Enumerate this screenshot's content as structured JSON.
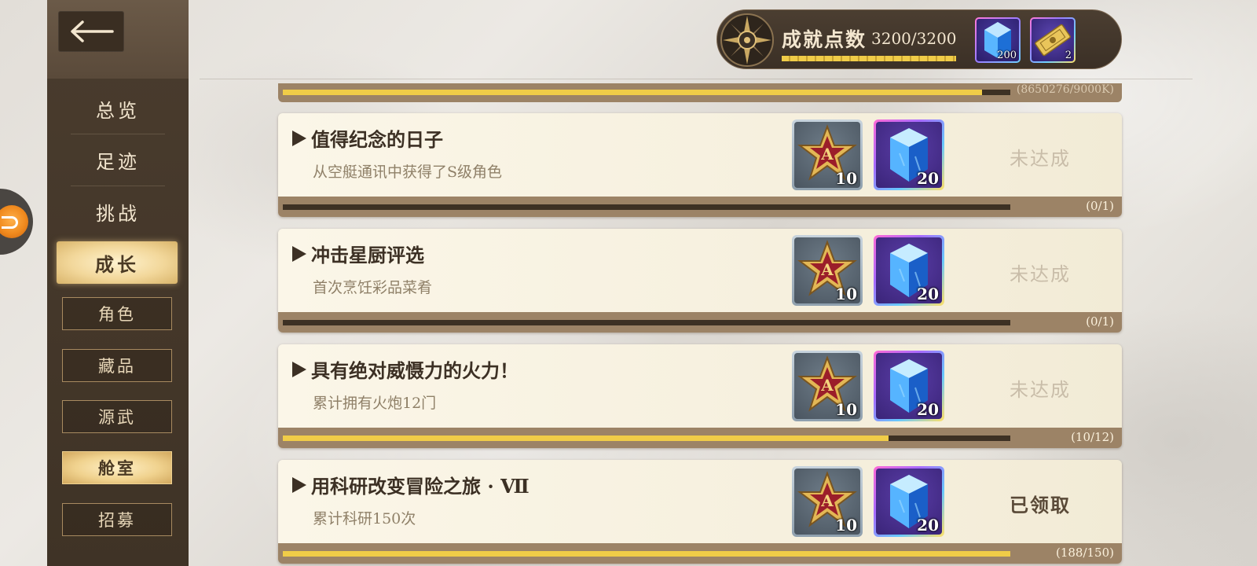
{
  "navigation": {
    "back_label": "",
    "main_items": [
      {
        "label": "总览",
        "active": false
      },
      {
        "label": "足迹",
        "active": false
      },
      {
        "label": "挑战",
        "active": false
      },
      {
        "label": "成长",
        "active": true
      }
    ],
    "sub_items": [
      {
        "label": "角色",
        "active": false
      },
      {
        "label": "藏品",
        "active": false
      },
      {
        "label": "源武",
        "active": false
      },
      {
        "label": "舱室",
        "active": true
      },
      {
        "label": "招募",
        "active": false
      }
    ]
  },
  "header": {
    "points_label": "成就点数",
    "points_value": "3200/3200",
    "points_progress": 1.0,
    "items": [
      {
        "icon": "crystal-icon",
        "quantity": "200"
      },
      {
        "icon": "ticket-icon",
        "quantity": "2"
      }
    ]
  },
  "previous_entry": {
    "count": "(8650276/9000K)",
    "progress": 0.961
  },
  "achievements": [
    {
      "title": "值得纪念的日子",
      "description": "从空艇通讯中获得了S级角色",
      "rewards": [
        {
          "icon": "a-rank-medal-icon",
          "quantity": "10"
        },
        {
          "icon": "blue-crystal-icon",
          "quantity": "20"
        }
      ],
      "status": "未达成",
      "claimed": false,
      "count": "(0/1)",
      "progress": 0
    },
    {
      "title": "冲击星厨评选",
      "description": "首次烹饪彩品菜肴",
      "rewards": [
        {
          "icon": "a-rank-medal-icon",
          "quantity": "10"
        },
        {
          "icon": "blue-crystal-icon",
          "quantity": "20"
        }
      ],
      "status": "未达成",
      "claimed": false,
      "count": "(0/1)",
      "progress": 0
    },
    {
      "title": "具有绝对威慑力的火力！",
      "description": "累计拥有火炮12门",
      "rewards": [
        {
          "icon": "a-rank-medal-icon",
          "quantity": "10"
        },
        {
          "icon": "blue-crystal-icon",
          "quantity": "20"
        }
      ],
      "status": "未达成",
      "claimed": false,
      "count": "(10/12)",
      "progress": 0.833
    },
    {
      "title": "用科研改变冒险之旅 · Ⅶ",
      "description": "累计科研150次",
      "rewards": [
        {
          "icon": "a-rank-medal-icon",
          "quantity": "10"
        },
        {
          "icon": "blue-crystal-icon",
          "quantity": "20"
        }
      ],
      "status": "已领取",
      "claimed": true,
      "count": "(188/150)",
      "progress": 1.0
    }
  ],
  "colors": {
    "accent_gold": "#f0cc48",
    "sidebar_bg": "#3f3326",
    "card_bg": "#fbf6e8",
    "footer_bg": "#9c8366"
  }
}
